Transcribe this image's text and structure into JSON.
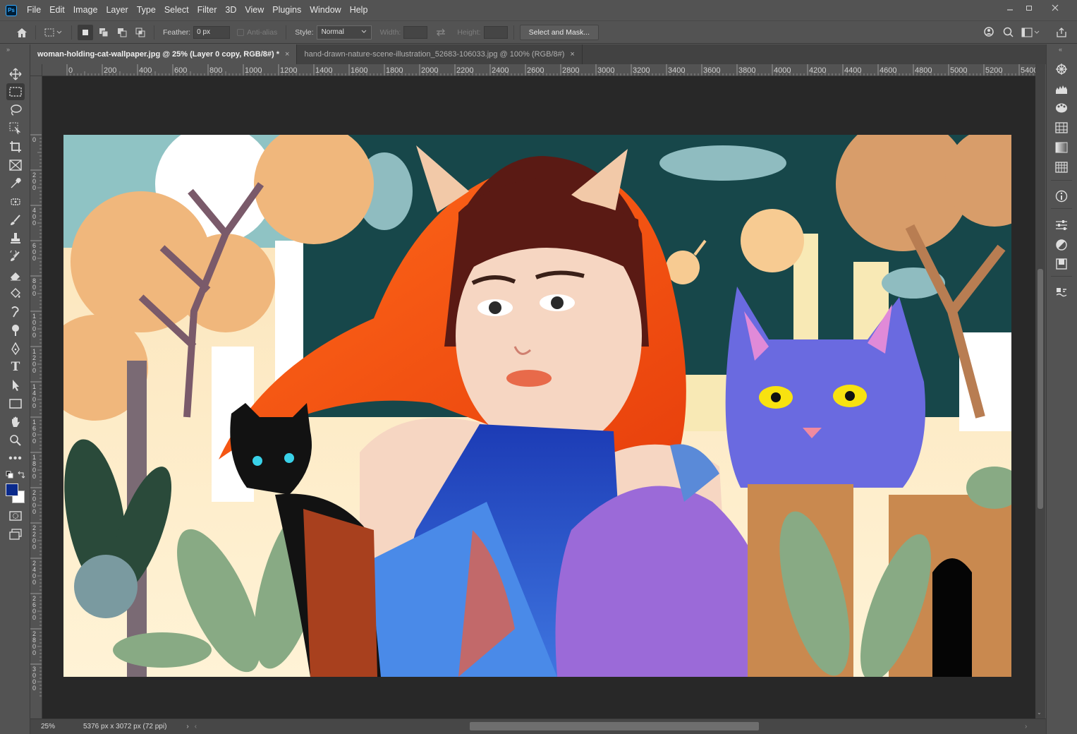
{
  "app": {
    "logo_text": "Ps"
  },
  "menu": [
    "File",
    "Edit",
    "Image",
    "Layer",
    "Type",
    "Select",
    "Filter",
    "3D",
    "View",
    "Plugins",
    "Window",
    "Help"
  ],
  "options": {
    "feather_label": "Feather:",
    "feather_value": "0 px",
    "antialias_label": "Anti-alias",
    "style_label": "Style:",
    "style_value": "Normal",
    "width_label": "Width:",
    "height_label": "Height:",
    "select_mask_label": "Select and Mask..."
  },
  "tabs": [
    {
      "label": "woman-holding-cat-wallpaper.jpg @ 25% (Layer 0 copy, RGB/8#) *",
      "close": "×"
    },
    {
      "label": "hand-drawn-nature-scene-illustration_52683-106033.jpg @ 100% (RGB/8#)",
      "close": "×"
    }
  ],
  "ruler_top": [
    "0",
    "200",
    "400",
    "600",
    "800",
    "1000",
    "1200",
    "1400",
    "1600",
    "1800",
    "2000",
    "2200",
    "2400",
    "2600",
    "2800",
    "3000",
    "3200",
    "3400",
    "3600",
    "3800",
    "4000",
    "4200",
    "4400",
    "4600",
    "4800",
    "5000",
    "5200",
    "5400"
  ],
  "ruler_left": [
    "0",
    "200",
    "400",
    "600",
    "800",
    "1000",
    "1200",
    "1400",
    "1600",
    "1800",
    "2000",
    "2200",
    "2400",
    "2600",
    "2800",
    "3000"
  ],
  "status": {
    "zoom": "25%",
    "doc_info": "5376 px x 3072 px (72 ppi)"
  },
  "colors": {
    "foreground": "#0a2a8c",
    "background": "#ffffff",
    "ps_blue": "#31a8ff"
  }
}
